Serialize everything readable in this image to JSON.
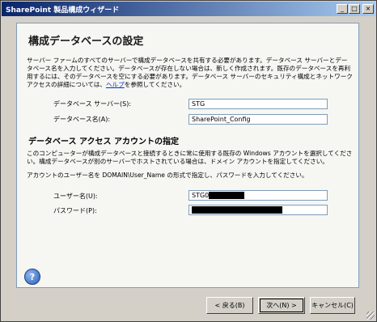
{
  "window": {
    "title": "SharePoint 製品構成ウィザード",
    "minimize_label": "_",
    "maximize_label": "□",
    "close_label": "×"
  },
  "page": {
    "heading": "構成データベースの設定",
    "description_pre": "サーバー ファームのすべてのサーバーで構成データベースを共有する必要があります。データベース サーバーとデータベース名を入力してください。データベースが存在しない場合は、新しく作成されます。既存のデータベースを再利用するには、そのデータベースを空にする必要があります。データベース サーバーのセキュリティ構成とネットワーク アクセスの詳細については、",
    "help_link": "ヘルプ",
    "description_post": "を参照してください。"
  },
  "fields": {
    "db_server_label": "データベース サーバー(S):",
    "db_server_value": "STG",
    "db_name_label": "データベース名(A):",
    "db_name_value": "SharePoint_Config"
  },
  "account": {
    "heading": "データベース アクセス アカウントの指定",
    "description": "このコンピューターが構成データベースと接続するときに常に使用する既存の Windows アカウントを選択してください。構成データベースが別のサーバーでホストされている場合は、ドメイン アカウントを指定してください。",
    "format_note": "アカウントのユーザー名を DOMAIN\\User_Name の形式で指定し、パスワードを入力してください。",
    "username_label": "ユーザー名(U):",
    "username_value": "STG0",
    "password_label": "パスワード(P):"
  },
  "buttons": {
    "help_icon": "?",
    "back": "< 戻る(B)",
    "next": "次へ(N) >",
    "cancel": "キャンセル(C)"
  },
  "colors": {
    "title_gradient_start": "#0a246a",
    "title_gradient_end": "#a6caf0",
    "link": "#0033cc"
  }
}
